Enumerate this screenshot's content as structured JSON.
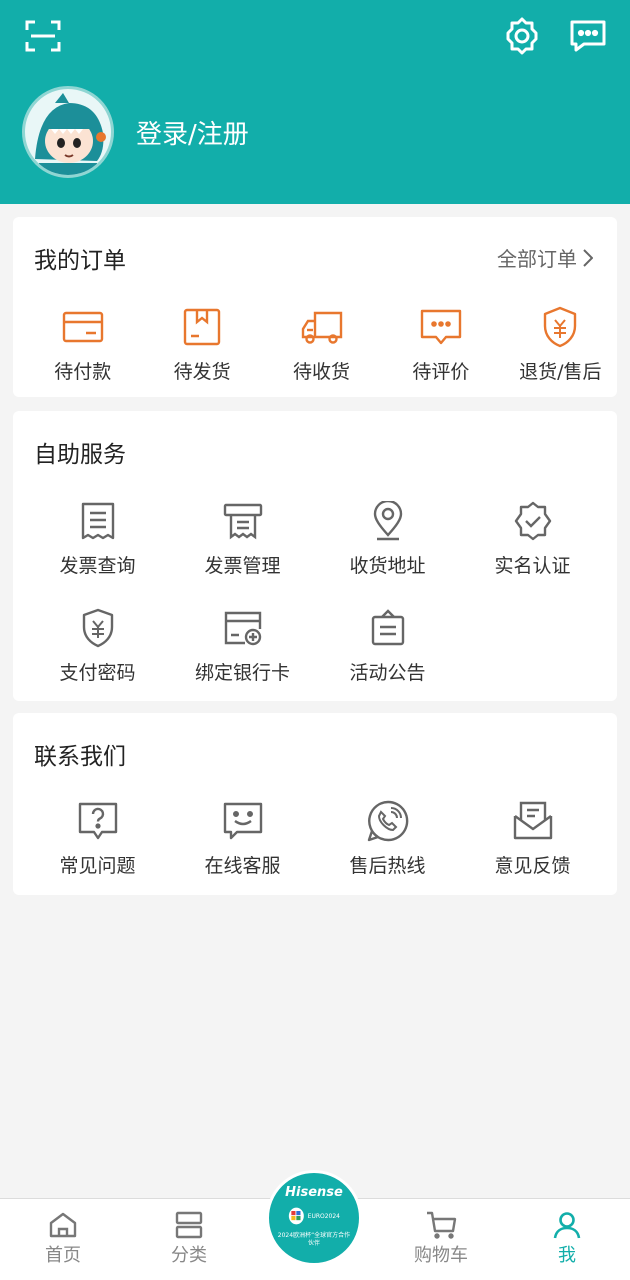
{
  "colors": {
    "primary": "#12aeaa",
    "order_icon": "#e8772e",
    "service_icon": "#666666"
  },
  "header": {
    "scan_icon": "scan-icon",
    "settings_icon": "gear-icon",
    "messages_icon": "message-icon",
    "login_label": "登录/注册"
  },
  "orders": {
    "title": "我的订单",
    "all_label": "全部订单",
    "items": [
      {
        "label": "待付款",
        "icon": "card-icon"
      },
      {
        "label": "待发货",
        "icon": "box-icon"
      },
      {
        "label": "待收货",
        "icon": "truck-icon"
      },
      {
        "label": "待评价",
        "icon": "comment-icon"
      },
      {
        "label": "退货/售后",
        "icon": "refund-shield-icon"
      }
    ]
  },
  "services": {
    "title": "自助服务",
    "items": [
      {
        "label": "发票查询",
        "icon": "invoice-icon"
      },
      {
        "label": "发票管理",
        "icon": "invoice-printer-icon"
      },
      {
        "label": "收货地址",
        "icon": "location-pin-icon"
      },
      {
        "label": "实名认证",
        "icon": "verified-badge-icon"
      },
      {
        "label": "支付密码",
        "icon": "payment-shield-icon"
      },
      {
        "label": "绑定银行卡",
        "icon": "bank-card-add-icon"
      },
      {
        "label": "活动公告",
        "icon": "notice-icon"
      }
    ]
  },
  "contact": {
    "title": "联系我们",
    "items": [
      {
        "label": "常见问题",
        "icon": "question-icon"
      },
      {
        "label": "在线客服",
        "icon": "chat-smile-icon"
      },
      {
        "label": "售后热线",
        "icon": "phone-icon"
      },
      {
        "label": "意见反馈",
        "icon": "feedback-mail-icon"
      }
    ]
  },
  "tabbar": {
    "home": "首页",
    "category": "分类",
    "cart": "购物车",
    "me": "我",
    "center_brand": "Hisense",
    "center_event": "EURO2024",
    "center_caption": "2024欧洲杯“全球官方合作伙伴"
  }
}
